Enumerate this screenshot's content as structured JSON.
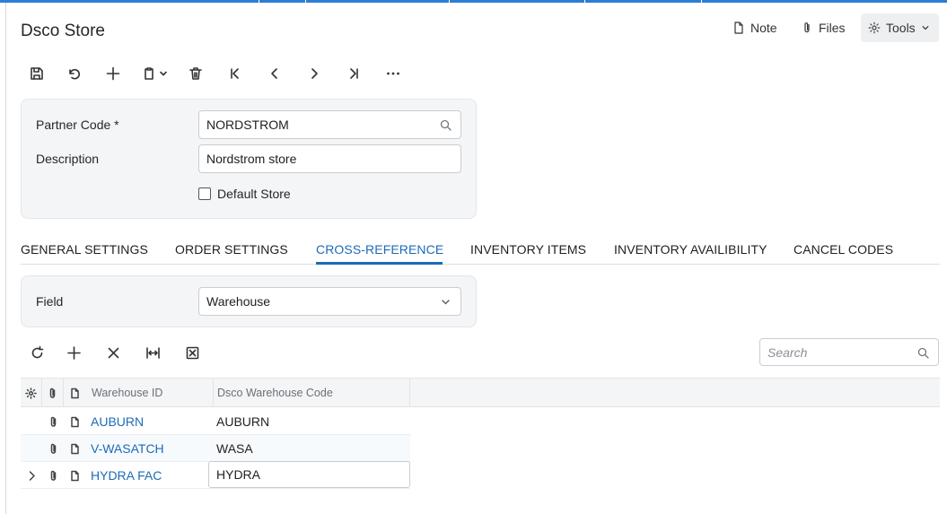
{
  "page": {
    "title": "Dsco Store"
  },
  "header_actions": {
    "note": "Note",
    "files": "Files",
    "tools": "Tools"
  },
  "toolbar": {
    "icons": [
      "save-icon",
      "undo-icon",
      "add-icon",
      "copy-paste-icon",
      "delete-icon",
      "first-record-icon",
      "previous-icon",
      "next-icon",
      "last-record-icon",
      "more-icon"
    ]
  },
  "form": {
    "partner_code_label": "Partner Code *",
    "partner_code_value": "NORDSTROM",
    "description_label": "Description",
    "description_value": "Nordstrom store",
    "default_store_label": "Default Store",
    "default_store_checked": false
  },
  "tabs": [
    {
      "label": "GENERAL SETTINGS",
      "active": false
    },
    {
      "label": "ORDER SETTINGS",
      "active": false
    },
    {
      "label": "CROSS-REFERENCE",
      "active": true
    },
    {
      "label": "INVENTORY ITEMS",
      "active": false
    },
    {
      "label": "INVENTORY AVAILIBILITY",
      "active": false
    },
    {
      "label": "CANCEL CODES",
      "active": false
    }
  ],
  "filter": {
    "field_label": "Field",
    "field_value": "Warehouse"
  },
  "grid_toolbar": {
    "icons": [
      "refresh-icon",
      "add-row-icon",
      "delete-row-icon",
      "fit-columns-icon",
      "export-excel-icon"
    ]
  },
  "search": {
    "placeholder": "Search"
  },
  "grid": {
    "columns": [
      "Warehouse ID",
      "Dsco Warehouse Code"
    ],
    "rows": [
      {
        "warehouse_id": "AUBURN",
        "dsco_code": "AUBURN"
      },
      {
        "warehouse_id": "V-WASATCH",
        "dsco_code": "WASA"
      },
      {
        "warehouse_id": "HYDRA FAC",
        "dsco_code": "HYDRA"
      }
    ]
  },
  "colors": {
    "accent": "#1c6bb7",
    "top_bar": "#2a7fd4",
    "panel": "#f4f5f7"
  }
}
